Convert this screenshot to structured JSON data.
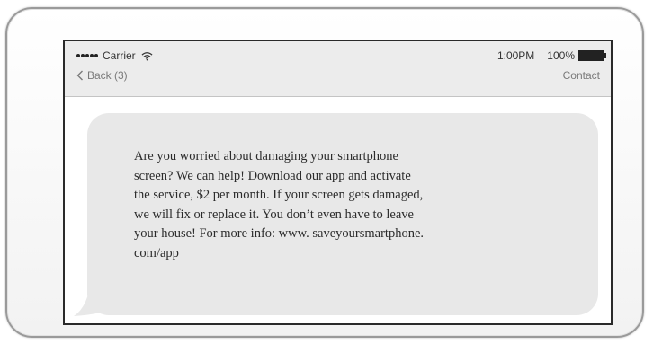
{
  "status_bar": {
    "carrier": "Carrier",
    "time": "1:00PM",
    "battery": "100%"
  },
  "nav_bar": {
    "back_label": "Back (3)",
    "contact_label": "Contact"
  },
  "message": {
    "text": "Are you worried about damaging your smartphone\nscreen? We can help! Download our app and activate\nthe service, $2 per month. If your screen gets damaged,\nwe will fix or replace it. You don’t even have to leave\nyour house! For more info: www. saveyoursmartphone.\ncom/app"
  },
  "icons": {
    "signal": "signal-dots-icon",
    "wifi": "wifi-icon",
    "battery": "battery-icon",
    "back": "chevron-left-icon"
  },
  "colors": {
    "bar_background": "#ececec",
    "bubble_background": "#e8e8e8",
    "text": "#2b2b2b"
  }
}
